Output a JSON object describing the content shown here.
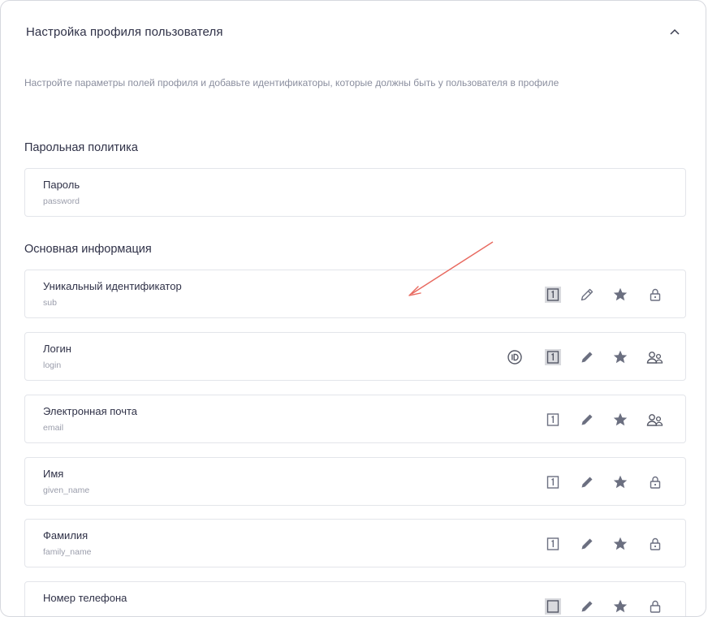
{
  "panel": {
    "title": "Настройка профиля пользователя",
    "description": "Настройте параметры полей профиля и добавьте идентификаторы, которые должны быть у пользователя в профиле"
  },
  "sections": {
    "password_policy": {
      "title": "Парольная политика"
    },
    "basic_info": {
      "title": "Основная информация"
    }
  },
  "fields": {
    "password": {
      "label": "Пароль",
      "key": "password"
    },
    "sub": {
      "label": "Уникальный идентификатор",
      "key": "sub"
    },
    "login": {
      "label": "Логин",
      "key": "login"
    },
    "email": {
      "label": "Электронная почта",
      "key": "email"
    },
    "given_name": {
      "label": "Имя",
      "key": "given_name"
    },
    "family_name": {
      "label": "Фамилия",
      "key": "family_name"
    },
    "phone": {
      "label": "Номер телефона",
      "key": ""
    }
  },
  "icons": {
    "identifier": "id-badge-icon",
    "required": "number-one-box-icon",
    "edit": "pencil-icon",
    "favorite": "star-icon",
    "lock": "lock-icon",
    "users": "users-icon"
  },
  "colors": {
    "annotation_arrow": "#e8695f",
    "icon": "#6b6f80"
  }
}
